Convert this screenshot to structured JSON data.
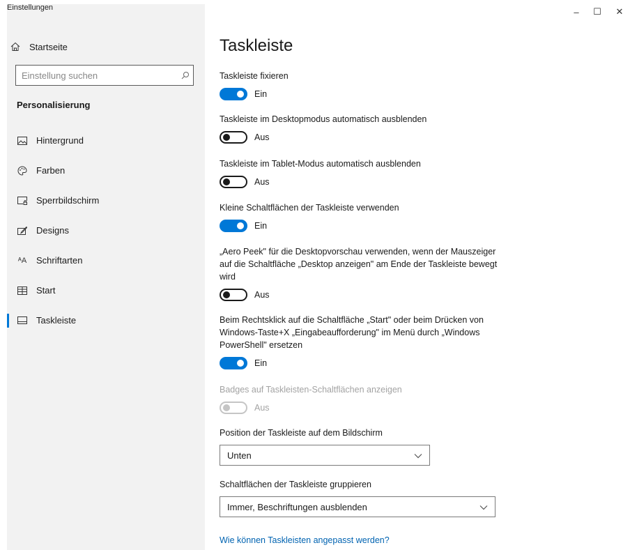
{
  "window": {
    "title": "Einstellungen",
    "controls": {
      "minimize": "–",
      "maximize": "☐",
      "close": "✕"
    }
  },
  "sidebar": {
    "home_label": "Startseite",
    "search_placeholder": "Einstellung suchen",
    "section_title": "Personalisierung",
    "items": [
      {
        "label": "Hintergrund",
        "icon": "image-icon"
      },
      {
        "label": "Farben",
        "icon": "palette-icon"
      },
      {
        "label": "Sperrbildschirm",
        "icon": "lock-screen-icon"
      },
      {
        "label": "Designs",
        "icon": "brush-icon"
      },
      {
        "label": "Schriftarten",
        "icon": "font-icon"
      },
      {
        "label": "Start",
        "icon": "start-icon"
      },
      {
        "label": "Taskleiste",
        "icon": "taskbar-icon",
        "active": true
      }
    ]
  },
  "main": {
    "title": "Taskleiste",
    "settings": [
      {
        "label": "Taskleiste fixieren",
        "state": "Ein",
        "on": true
      },
      {
        "label": "Taskleiste im Desktopmodus automatisch ausblenden",
        "state": "Aus",
        "on": false
      },
      {
        "label": "Taskleiste im Tablet-Modus automatisch ausblenden",
        "state": "Aus",
        "on": false
      },
      {
        "label": "Kleine Schaltflächen der Taskleiste verwenden",
        "state": "Ein",
        "on": true
      },
      {
        "label": "„Aero Peek\" für die Desktopvorschau verwenden, wenn der Mauszeiger auf die Schaltfläche „Desktop anzeigen\" am Ende der Taskleiste bewegt wird",
        "state": "Aus",
        "on": false
      },
      {
        "label": "Beim Rechtsklick auf die Schaltfläche „Start\" oder beim Drücken von Windows-Taste+X „Eingabeaufforderung\" im Menü durch „Windows PowerShell\" ersetzen",
        "state": "Ein",
        "on": true
      },
      {
        "label": "Badges auf Taskleisten-Schaltflächen anzeigen",
        "state": "Aus",
        "on": false,
        "disabled": true
      }
    ],
    "position": {
      "label": "Position der Taskleiste auf dem Bildschirm",
      "value": "Unten"
    },
    "grouping": {
      "label": "Schaltflächen der Taskleiste gruppieren",
      "value": "Immer, Beschriftungen ausblenden"
    },
    "help_link": "Wie können Taskleisten angepasst werden?"
  },
  "colors": {
    "accent": "#0078d7",
    "sidebar_bg": "#f2f2f2",
    "link": "#0063b1"
  }
}
